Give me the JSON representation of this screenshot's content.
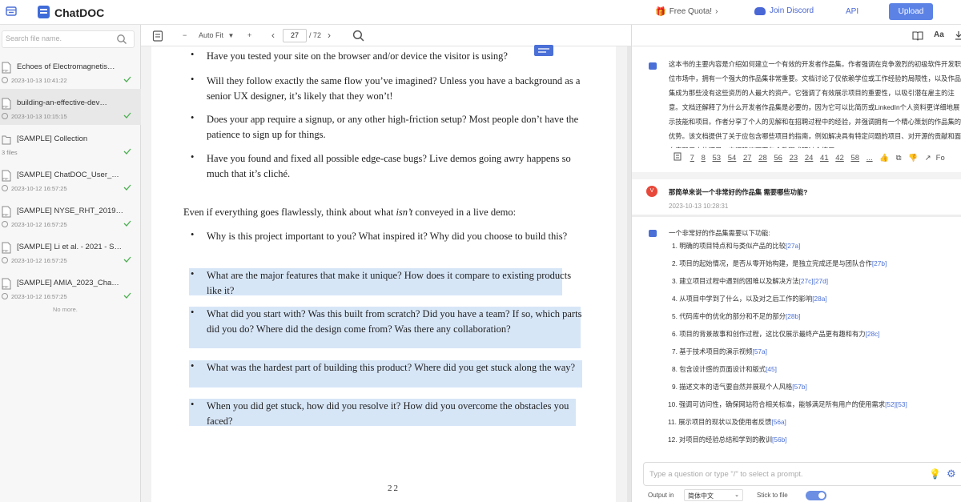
{
  "topbar": {
    "brand": "ChatDOC",
    "quota": "Free Quota!",
    "discord": "Join Discord",
    "api": "API",
    "upload": "Upload"
  },
  "sidebar": {
    "search_placeholder": "Search file name.",
    "files": [
      {
        "name": "Echoes of Electromagnetis…",
        "date": "2023-10-13 10:41:22"
      },
      {
        "name": "building-an-effective-dev…",
        "date": "2023-10-13 10:15:15"
      },
      {
        "name": "[SAMPLE] Collection",
        "date": "3 files"
      },
      {
        "name": "[SAMPLE] ChatDOC_User_…",
        "date": "2023-10-12 16:57:25"
      },
      {
        "name": "[SAMPLE] NYSE_RHT_2019…",
        "date": "2023-10-12 16:57:25"
      },
      {
        "name": "[SAMPLE] Li et al. - 2021 - S…",
        "date": "2023-10-12 16:57:25"
      },
      {
        "name": "[SAMPLE] AMIA_2023_Cha…",
        "date": "2023-10-12 16:57:25"
      }
    ],
    "no_more": "No more."
  },
  "doc_toolbar": {
    "zoom_minus": "−",
    "zoom": "Auto Fit",
    "zoom_plus": "+",
    "page": "27",
    "total": "/ 72"
  },
  "doc": {
    "bullets_top": [
      "Have you tested your site on the browser and/or device the visitor is using?",
      "Will they follow exactly the same flow you’ve imagined? Unless you have a background as a senior UX designer, it’s likely that they won’t!",
      "Does your app require a signup, or any other high-friction setup? Most people don’t have the patience to sign up for things.",
      "Have you found and fixed all possible edge-case bugs? Live demos going awry happens so much that it’s cliché."
    ],
    "para_before": "Even if everything goes flawlessly, think about what",
    "para_em": "isn’t",
    "para_after": "conveyed in a live demo:",
    "bullets_bottom": [
      "Why is this project important to you? What inspired it? Why did you choose to build this?",
      "What are the major features that make it unique? How does it compare to existing products like it?",
      "What did you start with? Was this built from scratch? Did you have a team? If so, which parts did you do? Where did the design come from? Was there any collaboration?",
      "What was the hardest part of building this product? Where did you get stuck along the way?",
      "When you did get stuck, how did you resolve it? How did you overcome the obstacles you faced?"
    ],
    "page_number": "22"
  },
  "chat": {
    "summary": "这本书的主要内容是介绍如何建立一个有效的开发者作品集。作者强调在竞争激烈的初级软件开发职位市场中，拥有一个强大的作品集非常重要。文档讨论了仅依赖学位或工作经验的局限性，以及作品集成为那些没有这些资历的人最大的资产。它强调了有效展示项目的重要性，以吸引潜在雇主的注意。文档还解释了为什么开发者作品集是必要的，因为它可以比简历或LinkedIn个人资料更详细地展示技能和项目。作者分享了个人的见解和在招聘过程中的经验，并强调拥有一个精心策划的作品集的优势。该文档提供了关于应包含哪些项目的指南，例如解决具有特定问题的项目、对开源的贡献和面向实际用户的项目。它还建议不要包含教程或研讨会练习。",
    "refs": [
      "7",
      "8",
      "53",
      "54",
      "27",
      "28",
      "56",
      "23",
      "24",
      "41",
      "42",
      "58",
      "..."
    ],
    "follow_label": "Fo",
    "avatar_letter": "V",
    "question": "那简单来说一个非常好的作品集 需要哪些功能?",
    "question_date": "2023-10-13 10:28:31",
    "answer_intro": "一个非常好的作品集需要以下功能:",
    "answers": [
      {
        "n": "1.",
        "t": "明确的项目特点和与类似产品的比较",
        "r": "[27a]"
      },
      {
        "n": "2.",
        "t": "项目的起始情况，是否从零开始构建，是独立完成还是与团队合作",
        "r": "[27b]"
      },
      {
        "n": "3.",
        "t": "建立项目过程中遇到的困难以及解决方法",
        "r": "[27c][27d]"
      },
      {
        "n": "4.",
        "t": "从项目中学到了什么，以及对之后工作的影响",
        "r": "[28a]"
      },
      {
        "n": "5.",
        "t": "代码库中的优化的部分和不足的部分",
        "r": "[28b]"
      },
      {
        "n": "6.",
        "t": "项目的背景故事和创作过程，这比仅展示最终产品更有趣和有力",
        "r": "[28c]"
      },
      {
        "n": "7.",
        "t": "基于技术项目的演示视频",
        "r": "[57a]"
      },
      {
        "n": "8.",
        "t": "包含设计感的页面设计和版式",
        "r": "[45]"
      },
      {
        "n": "9.",
        "t": "描述文本的语气要自然并展现个人风格",
        "r": "[57b]"
      },
      {
        "n": "10.",
        "t": "强调可访问性，确保网站符合相关标准，能够满足所有用户的使用需求",
        "r": "[52][53]"
      },
      {
        "n": "11.",
        "t": "展示项目的现状以及使用者反馈",
        "r": "[56a]"
      },
      {
        "n": "12.",
        "t": "对项目的经验总结和学到的教训",
        "r": "[56b]"
      }
    ],
    "input_placeholder": "Type a question or type \"/\" to select a prompt.",
    "output_label": "Output in",
    "output_value": "简体中文",
    "stick_label": "Stick to file"
  }
}
